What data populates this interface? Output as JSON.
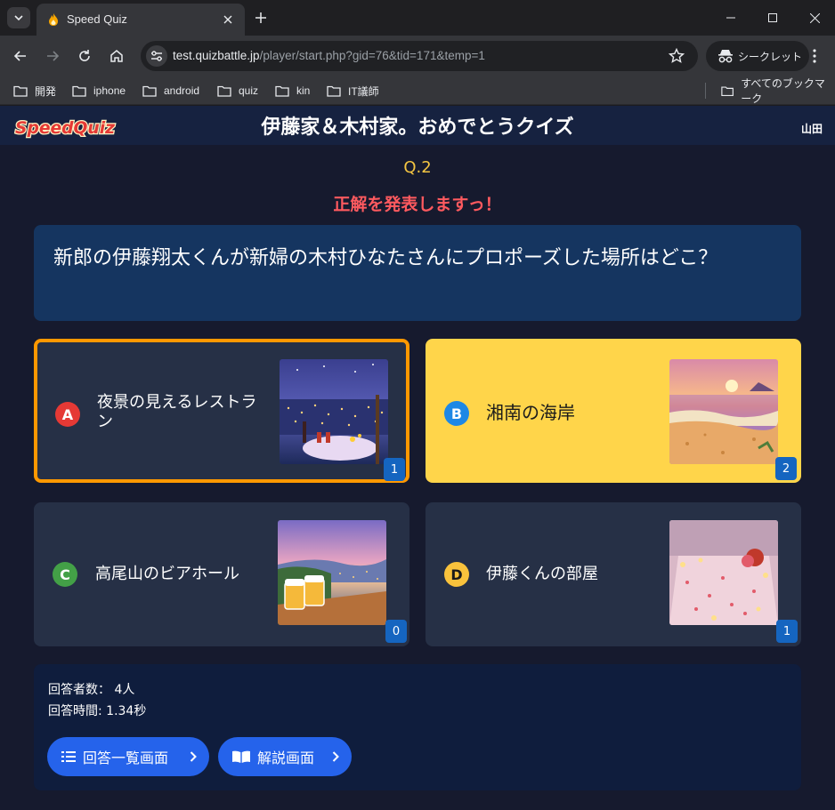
{
  "browser": {
    "tab_title": "Speed Quiz",
    "url_host": "test.quizbattle.jp",
    "url_path": "/player/start.php?gid=76&tid=171&temp=1",
    "incognito_label": "シークレット",
    "bookmarks": [
      "開発",
      "iphone",
      "android",
      "quiz",
      "kin",
      "IT議師"
    ],
    "all_bookmarks_label": "すべてのブックマーク"
  },
  "header": {
    "logo_text": "SpeedQuiz",
    "title": "伊藤家＆木村家。おめでとうクイズ",
    "user": "山田"
  },
  "quiz": {
    "question_number": "Q.2",
    "announcement": "正解を発表しますっ！",
    "question": "新郎の伊藤翔太くんが新婦の木村ひなたさんにプロポーズした場所はどこ？",
    "choices": [
      {
        "letter": "A",
        "text": "夜景の見えるレストラン",
        "count": "1",
        "state": "selected",
        "image": "night-view-restaurant-image",
        "badge_color": "#e53935"
      },
      {
        "letter": "B",
        "text": "湘南の海岸",
        "count": "2",
        "state": "correct",
        "image": "shonan-beach-sunset-image",
        "badge_color": "#1e88e5"
      },
      {
        "letter": "C",
        "text": "高尾山のビアホール",
        "count": "0",
        "state": "normal",
        "image": "mountain-beer-hall-image",
        "badge_color": "#43a047"
      },
      {
        "letter": "D",
        "text": "伊藤くんの部屋",
        "count": "1",
        "state": "normal",
        "image": "candlelit-room-image",
        "badge_color": "#f9c23c"
      }
    ]
  },
  "stats": {
    "respondents": "回答者数： 4人",
    "answer_time": "回答時間: 1.34秒",
    "list_button": "回答一覧画面",
    "explain_button": "解説画面"
  },
  "colors": {
    "accent_orange": "#ff9800",
    "correct_yellow": "#ffd54a",
    "button_blue": "#2563eb"
  }
}
